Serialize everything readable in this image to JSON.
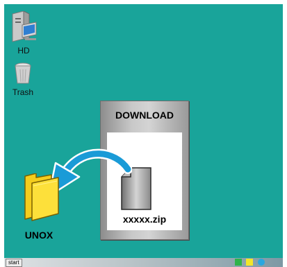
{
  "desktop": {
    "background_color": "#19a49a",
    "icons": {
      "hd": {
        "label": "HD",
        "icon": "hard-drive-computer-icon"
      },
      "trash": {
        "label": "Trash",
        "icon": "trash-can-icon"
      },
      "unox": {
        "label": "UNOX",
        "icon": "folder-icon"
      }
    }
  },
  "download_window": {
    "title": "DOWNLOAD",
    "file": {
      "name": "xxxxx.zip",
      "icon": "file-icon"
    }
  },
  "drag_hint": {
    "icon": "curved-arrow-icon",
    "color": "#1a9bd7"
  },
  "taskbar": {
    "start_label": "start",
    "tray": [
      "green-square-icon",
      "yellow-square-icon",
      "blue-circle-icon"
    ]
  }
}
